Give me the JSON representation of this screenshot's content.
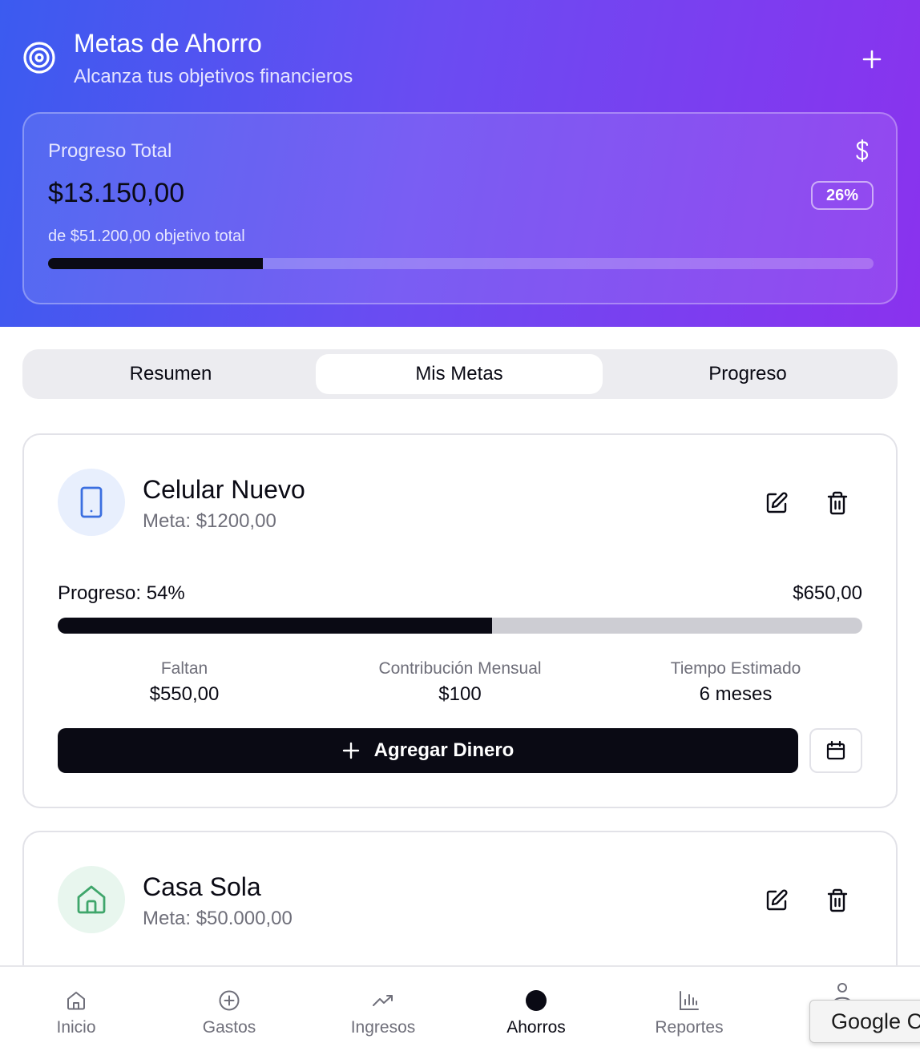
{
  "header": {
    "title": "Metas de Ahorro",
    "subtitle": "Alcanza tus objetivos financieros",
    "icons": {
      "app": "target-icon",
      "add": "plus-icon"
    }
  },
  "total": {
    "label": "Progreso Total",
    "amount": "$13.150,00",
    "percent_label": "26%",
    "goal_text": "de $51.200,00 objetivo total",
    "progress_fraction": 0.26,
    "icon": "dollar-icon"
  },
  "tabs": [
    {
      "label": "Resumen",
      "active": false
    },
    {
      "label": "Mis Metas",
      "active": true
    },
    {
      "label": "Progreso",
      "active": false
    }
  ],
  "goals": [
    {
      "name": "Celular Nuevo",
      "meta": "Meta: $1200,00",
      "icon": "smartphone-icon",
      "icon_color": "#3b6fe0",
      "icon_bg": "#e8effd",
      "progress_label": "Progreso: 54%",
      "progress_fraction": 0.54,
      "saved": "$650,00",
      "stats": [
        {
          "label": "Faltan",
          "value": "$550,00"
        },
        {
          "label": "Contribución Mensual",
          "value": "$100"
        },
        {
          "label": "Tiempo Estimado",
          "value": "6 meses"
        }
      ],
      "add_button": "Agregar Dinero"
    },
    {
      "name": "Casa Sola",
      "meta": "Meta: $50.000,00",
      "icon": "house-icon",
      "icon_color": "#3fa66b",
      "icon_bg": "#e8f6ee"
    }
  ],
  "nav": [
    {
      "label": "Inicio",
      "icon": "home-icon",
      "active": false
    },
    {
      "label": "Gastos",
      "icon": "plus-circle-icon",
      "active": false
    },
    {
      "label": "Ingresos",
      "icon": "trending-up-icon",
      "active": false
    },
    {
      "label": "Ahorros",
      "icon": "dot-icon",
      "active": true
    },
    {
      "label": "Reportes",
      "icon": "bar-chart-icon",
      "active": false
    },
    {
      "label": "",
      "icon": "user-icon",
      "active": false
    }
  ],
  "tooltip": {
    "text": "Google C"
  },
  "colors": {
    "gradient_start": "#3b5bf0",
    "gradient_end": "#8a32ee",
    "primary": "#0a0a14",
    "muted": "#6f6f7a"
  }
}
